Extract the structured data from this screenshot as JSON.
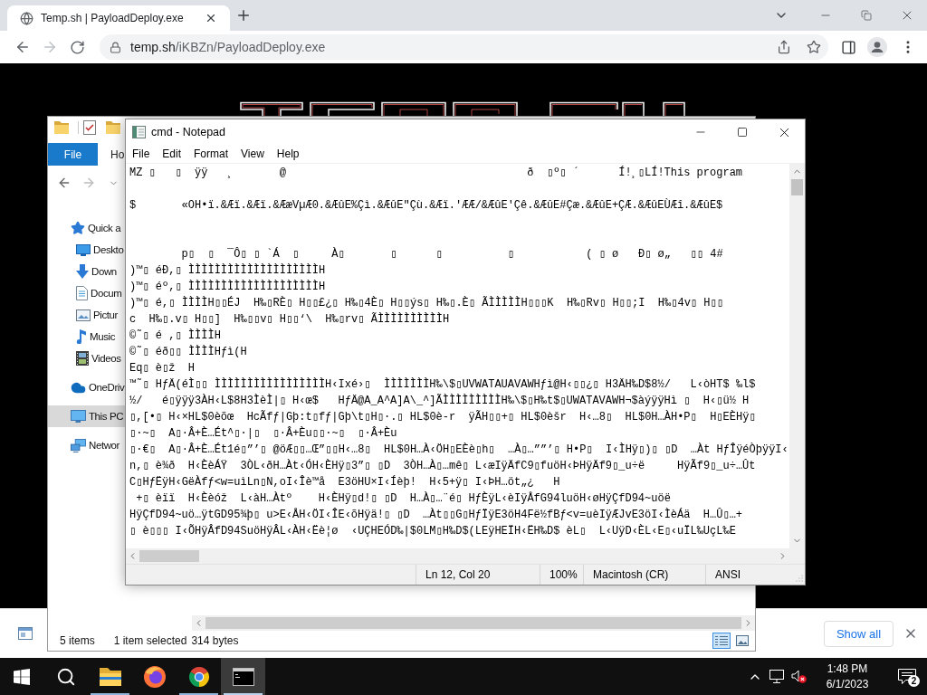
{
  "browser": {
    "tabs": [
      {
        "title": "Temp.sh | PayloadDeploy.exe",
        "selected": true
      }
    ],
    "nav": {
      "back_disabled": false,
      "forward_disabled": true
    },
    "address_bar": {
      "host": "temp.sh",
      "path": "/iKBZn/PayloadDeploy.exe"
    }
  },
  "download_bar": {
    "show_all": "Show all"
  },
  "explorer": {
    "ribbon_tabs": [
      {
        "label": "File",
        "kind": "menu"
      },
      {
        "label": "Ho",
        "kind": "tab"
      }
    ],
    "nav_pane": [
      {
        "label": "Quick a",
        "kind": "quick_access",
        "selected": false,
        "children": [
          {
            "label": "Deskto",
            "kind": "desktop",
            "selected": false
          },
          {
            "label": "Down",
            "kind": "downloads",
            "selected": false
          },
          {
            "label": "Docum",
            "kind": "documents",
            "selected": false
          },
          {
            "label": "Pictur",
            "kind": "pictures",
            "selected": false
          },
          {
            "label": "Music",
            "kind": "music",
            "selected": false
          },
          {
            "label": "Videos",
            "kind": "videos",
            "selected": false
          }
        ]
      },
      {
        "label": "OneDriv",
        "kind": "onedrive",
        "selected": false
      },
      {
        "label": "This PC",
        "kind": "this_pc",
        "selected": true
      },
      {
        "label": "Networ",
        "kind": "network",
        "selected": false
      }
    ],
    "status": {
      "item_count": "5 items",
      "selection": "1 item selected",
      "size": "314 bytes"
    },
    "view_buttons": [
      {
        "kind": "details",
        "selected": true
      },
      {
        "kind": "large_icons",
        "selected": false
      }
    ]
  },
  "notepad": {
    "title": "cmd - Notepad",
    "menu": [
      "File",
      "Edit",
      "Format",
      "View",
      "Help"
    ],
    "text": "MZ ▯   ▯  ÿÿ   ¸       @                                     ð  ▯º▯ ´      Í!¸▯LÍ!This program\n\n$       «OH•ï.&Æï.&Æï.&ÆæVµÆ0.&ÆûE%Çì.&ÆûE\"Çù.&Æï.'ÆÆ/&ÆûE'Çê.&ÆûE#Çæ.&ÆûE+ÇÆ.&ÆûEÙÆî.&ÆûE$\n\n\n        p▯  ▯  ¯Ô▯ ▯ `Á  ▯     À▯       ▯      ▯          ▯           ( ▯ ø   Ð▯ ø„   ▯▯ 4#\n)™▯ éÐ,▯ ÌÌÌÌÌÌÌÌÌÌÌÌÌÌÌÌÌÌÌÌH\n)™▯ éº,▯ ÌÌÌÌÌÌÌÌÌÌÌÌÌÌÌÌÌÌÌÌH\n)™▯ é,▯ ÌÌÌÌH▯▯ÉJ  H‰▯RÈ▯ H▯▯£¿▯ H‰▯4È▯ H▯▯ýs▯ H‰▯.È▯ ÃÌÌÌÌÌH▯▯▯K  H‰▯Rv▯ H▯▯;I  H‰▯4v▯ H▯▯\nc  H‰▯.v▯ H▯▯]  H‰▯▯v▯ H▯▯‘\\  H‰▯rv▯ ÃÌÌÌÌÌÌÌÌÌÌH\n©˜▯ é ,▯ ÌÌÌÌH\n©˜▯ éð▯▯ ÌÌÌÌHƒì(H\nEq▯ è▯ž  H\n™˜▯ HƒÄ(éÌ▯▯ ÌÌÌÌÌÌÌÌÌÌÌÌÌÌÌÌÌH‹Ixé›▯  ÌÌÌÌÌÌÌH‰\\$▯UVWATAUAVAWHƒì@H‹▯▯¿▯ H3ÄH‰D$8½/   L‹òHT$ ‰l$\n½/   é▯ÿÿÿ3ÀH‹L$8H3ÌèÌ|▯ H‹œ$   HƒÄ@A_A^A]A\\_^]ÃÌÌÌÌÌÌÌÌÌH‰\\$▯H‰t$▯UWATAVAWH¬$àýÿÿHì ▯  H‹▯ü½ H\n▯,[•▯ H‹×HL$0èõœ  HcÃfƒ|Gþ:t▯fƒ|Gþ\\t▯H▯·.▯ HL$0è-r  ÿÃH▯▯+▯ HL$0èšr  H‹…8▯  HL$0H…ÀH•P▯  H▯EÈHÿ▯\n▯·~▯  A▯·Â+È…Ét^▯·|▯  ▯·Â+Èu▯▯·~▯  ▯·Â+Èu\n▯·€▯  A▯·Â+È…Ét1é▯”’▯ @öÆ▯▯…Œ”▯▯H‹…8▯  HL$0H…À‹ÖH▯EÈè▯h▯  …À▯…””’▯ H•P▯  I‹ÌHÿ▯)▯ ▯D  …Àt HƒÎÿéÒþÿÿI‹\nn,▯ è¾ð  H‹ÈèÁŸ  3ÒL‹ðH…Àt‹ÓH‹ÈHÿ▯3”▯ ▯D  3ÒH…À▯…mê▯ L‹æIÿÄfC9▯fuöH‹ÞHÿÄf9▯_u÷ë     HÿÃf9▯_u÷…Ût\nC▯HƒËÿH‹GëÀfƒ<w=uìLn▯N,oI‹Îè™å  E3öHU×I‹Íèþ!  H‹5+ÿ▯ I‹ÞH…öt„¿   H\n +▯ èïï  H‹Èèóž  L‹àH…Àtº    H‹ÈHÿ▯d!▯ ▯D  H…À▯…¨é▯ HƒÈÿL‹èIÿÅfG94luöH‹øHÿÇfD94~uöë\nHÿÇfD94~uö…ÿtGD95¾þ▯ u>E‹ÅH‹ÖI‹ÎE‹õHÿä!▯ ▯D  …Àt▯▯G▯HƒÏÿE3öH4Fë½fBƒ<v=uèIÿÆJvE3öI‹ÌèÁä  H…Û▯…+\n▯ è▯▯▯ I‹ÕHÿÂfD94SuöHÿÂL‹ÀH‹Ëè¦ø  ‹UÇHEÓD‰|$0LM▯H‰D$(LEÿHEÏH‹ËH‰D$ èL▯  L‹UÿD‹ÈL‹E▯‹uÏL‰UçL‰E",
    "status": {
      "position": "Ln 12, Col 20",
      "zoom": "100%",
      "line_endings": "Macintosh (CR)",
      "encoding": "ANSI"
    }
  },
  "taskbar": {
    "apps": [
      {
        "kind": "file_explorer",
        "running": true,
        "active": false
      },
      {
        "kind": "firefox",
        "running": false,
        "active": false
      },
      {
        "kind": "chrome",
        "running": true,
        "active": false
      },
      {
        "kind": "terminal",
        "running": true,
        "active": true
      }
    ],
    "tray": {
      "volume_muted": true,
      "time": "1:48 PM",
      "date": "6/1/2023",
      "notification_count": "2"
    }
  }
}
